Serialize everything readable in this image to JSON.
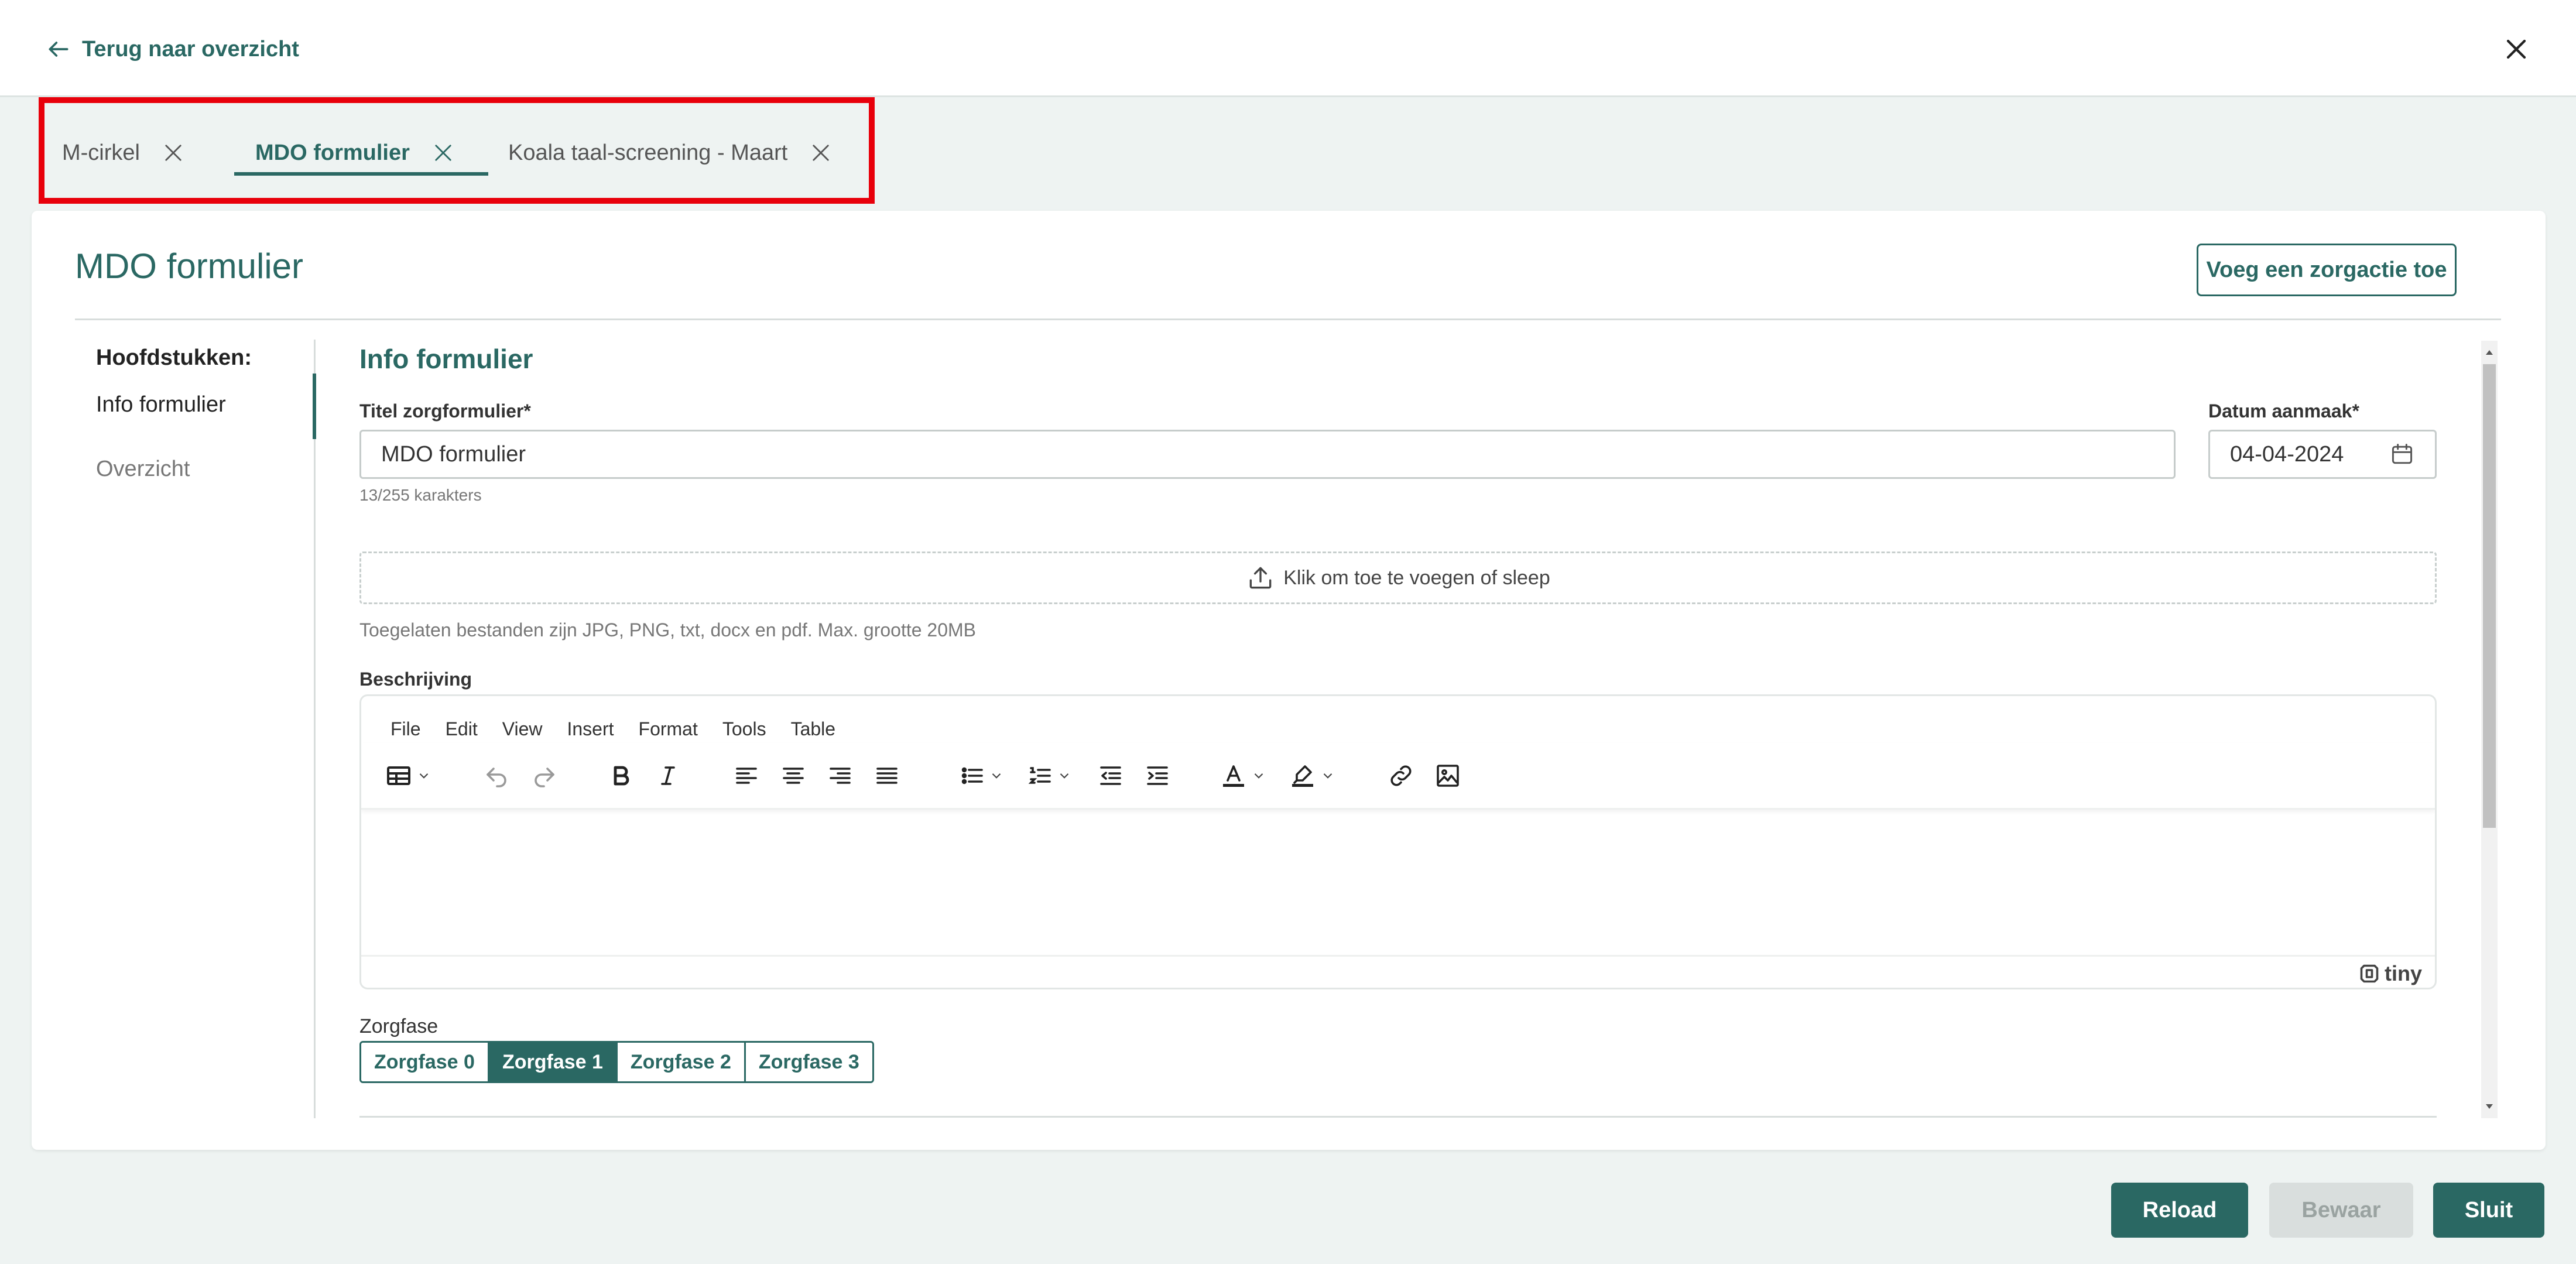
{
  "header": {
    "back_label": "Terug naar overzicht"
  },
  "tabs": [
    {
      "label": "M-cirkel",
      "active": false
    },
    {
      "label": "MDO formulier",
      "active": true
    },
    {
      "label": "Koala taal-screening - Maart",
      "active": false
    }
  ],
  "card": {
    "title": "MDO formulier",
    "add_action_label": "Voeg een zorgactie toe"
  },
  "nav": {
    "heading": "Hoofdstukken:",
    "items": [
      {
        "label": "Info formulier",
        "active": true
      },
      {
        "label": "Overzicht",
        "active": false
      }
    ]
  },
  "form": {
    "section_title": "Info formulier",
    "title_label": "Titel zorgformulier*",
    "title_value": "MDO formulier",
    "char_count": "13/255 karakters",
    "date_label": "Datum aanmaak*",
    "date_value": "04-04-2024",
    "upload_label": "Klik om toe te voegen of sleep",
    "allowed_files": "Toegelaten bestanden zijn JPG, PNG, txt, docx en pdf. Max. grootte 20MB",
    "description_label": "Beschrijving",
    "editor_menu": [
      "File",
      "Edit",
      "View",
      "Insert",
      "Format",
      "Tools",
      "Table"
    ],
    "editor_brand": "tiny",
    "phase_label": "Zorgfase",
    "phases": [
      {
        "label": "Zorgfase 0",
        "active": false
      },
      {
        "label": "Zorgfase 1",
        "active": true
      },
      {
        "label": "Zorgfase 2",
        "active": false
      },
      {
        "label": "Zorgfase 3",
        "active": false
      }
    ]
  },
  "footer": {
    "reload_label": "Reload",
    "save_label": "Bewaar",
    "close_label": "Sluit"
  },
  "colors": {
    "accent": "#2a6863",
    "highlight": "#e8000b",
    "background": "#eef3f2"
  },
  "icons": [
    "arrow-left-icon",
    "close-icon",
    "upload-icon",
    "calendar-icon",
    "table-icon",
    "undo-icon",
    "redo-icon",
    "bold-icon",
    "italic-icon",
    "align-left-icon",
    "align-center-icon",
    "align-right-icon",
    "align-justify-icon",
    "bullet-list-icon",
    "numbered-list-icon",
    "outdent-icon",
    "indent-icon",
    "text-color-icon",
    "highlight-icon",
    "link-icon",
    "image-icon",
    "tiny-logo-icon"
  ]
}
